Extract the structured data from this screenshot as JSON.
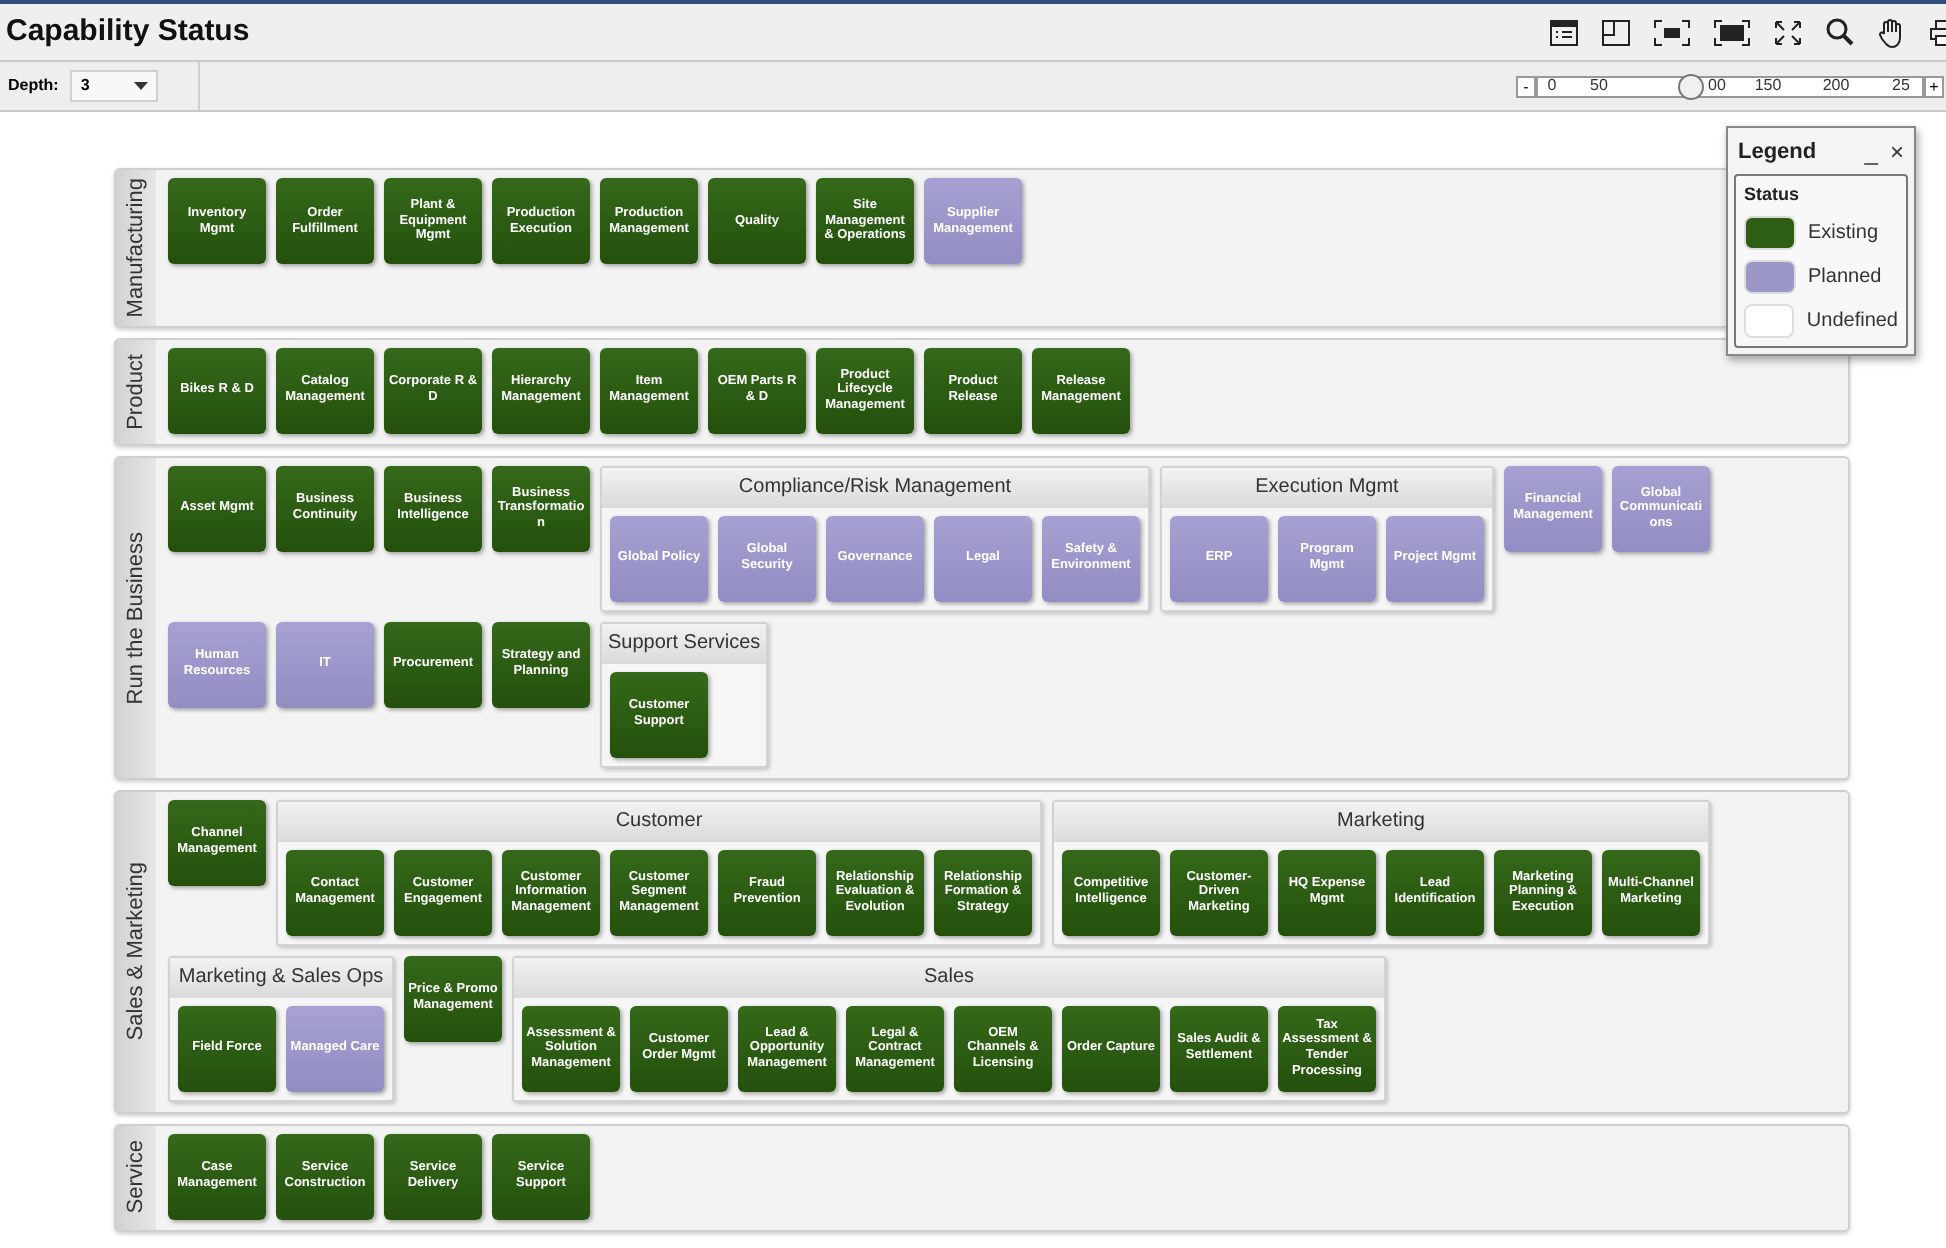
{
  "title": "Capability Status",
  "toolbar": {
    "depth_label": "Depth:",
    "depth_value": "3",
    "zoom": {
      "minus": "-",
      "plus": "+",
      "labels": [
        "0",
        "50",
        "00",
        "150",
        "200",
        "25"
      ],
      "level": 0.4
    }
  },
  "lanes": [
    {
      "label": "Manufacturing",
      "rows": [
        [
          {
            "kind": "capability",
            "name": "Inventory Mgmt",
            "planned": false
          },
          {
            "kind": "capability",
            "name": "Order Fulfillment",
            "planned": false
          },
          {
            "kind": "capability",
            "name": "Plant & Equipment Mgmt",
            "planned": false
          },
          {
            "kind": "capability",
            "name": "Production Execution",
            "planned": false
          },
          {
            "kind": "capability",
            "name": "Production Management",
            "planned": false
          },
          {
            "kind": "capability",
            "name": "Quality",
            "planned": false
          },
          {
            "kind": "capability",
            "name": "Site Management & Operations",
            "planned": false
          },
          {
            "kind": "capability",
            "name": "Supplier Management",
            "planned": true
          }
        ]
      ]
    },
    {
      "label": "Product",
      "rows": [
        [
          {
            "kind": "capability",
            "name": "Bikes R & D",
            "planned": false
          },
          {
            "kind": "capability",
            "name": "Catalog Management",
            "planned": false
          },
          {
            "kind": "capability",
            "name": "Corporate R & D",
            "planned": false
          },
          {
            "kind": "capability",
            "name": "Hierarchy Management",
            "planned": false
          },
          {
            "kind": "capability",
            "name": "Item Management",
            "planned": false
          },
          {
            "kind": "capability",
            "name": "OEM Parts R & D",
            "planned": false
          },
          {
            "kind": "capability",
            "name": "Product Lifecycle Management",
            "planned": false
          },
          {
            "kind": "capability",
            "name": "Product Release",
            "planned": false
          },
          {
            "kind": "capability",
            "name": "Release Management",
            "planned": false
          }
        ]
      ]
    },
    {
      "label": "Run the Business",
      "rows": [
        [
          {
            "kind": "capability",
            "name": "Asset Mgmt",
            "planned": false
          },
          {
            "kind": "capability",
            "name": "Business Continuity",
            "planned": false
          },
          {
            "kind": "capability",
            "name": "Business Intelligence",
            "planned": false
          },
          {
            "kind": "capability",
            "name": "Business Transformation",
            "planned": false
          },
          {
            "kind": "group",
            "name": "Compliance/Risk Management",
            "children": [
              {
                "kind": "capability",
                "name": "Global Policy",
                "planned": true
              },
              {
                "kind": "capability",
                "name": "Global Security",
                "planned": true
              },
              {
                "kind": "capability",
                "name": "Governance",
                "planned": true
              },
              {
                "kind": "capability",
                "name": "Legal",
                "planned": true
              },
              {
                "kind": "capability",
                "name": "Safety & Environment",
                "planned": true
              }
            ]
          },
          {
            "kind": "group",
            "name": "Execution Mgmt",
            "children": [
              {
                "kind": "capability",
                "name": "ERP",
                "planned": true
              },
              {
                "kind": "capability",
                "name": "Program Mgmt",
                "planned": true
              },
              {
                "kind": "capability",
                "name": "Project Mgmt",
                "planned": true
              }
            ]
          },
          {
            "kind": "capability",
            "name": "Financial Management",
            "planned": true
          },
          {
            "kind": "capability",
            "name": "Global Communications",
            "planned": true
          }
        ],
        [
          {
            "kind": "capability",
            "name": "Human Resources",
            "planned": true
          },
          {
            "kind": "capability",
            "name": "IT",
            "planned": true
          },
          {
            "kind": "capability",
            "name": "Procurement",
            "planned": false
          },
          {
            "kind": "capability",
            "name": "Strategy and Planning",
            "planned": false
          },
          {
            "kind": "group",
            "name": "Support Services",
            "children": [
              {
                "kind": "capability",
                "name": "Customer Support",
                "planned": false
              }
            ]
          }
        ]
      ]
    },
    {
      "label": "Sales & Marketing",
      "rows": [
        [
          {
            "kind": "capability",
            "name": "Channel Management",
            "planned": false
          },
          {
            "kind": "group",
            "name": "Customer",
            "children": [
              {
                "kind": "capability",
                "name": "Contact Management",
                "planned": false
              },
              {
                "kind": "capability",
                "name": "Customer Engagement",
                "planned": false
              },
              {
                "kind": "capability",
                "name": "Customer Information Management",
                "planned": false
              },
              {
                "kind": "capability",
                "name": "Customer Segment Management",
                "planned": false
              },
              {
                "kind": "capability",
                "name": "Fraud Prevention",
                "planned": false
              },
              {
                "kind": "capability",
                "name": "Relationship Evaluation & Evolution",
                "planned": false
              },
              {
                "kind": "capability",
                "name": "Relationship Formation & Strategy",
                "planned": false
              }
            ]
          },
          {
            "kind": "group",
            "name": "Marketing",
            "children": [
              {
                "kind": "capability",
                "name": "Competitive Intelligence",
                "planned": false
              },
              {
                "kind": "capability",
                "name": "Customer-Driven Marketing",
                "planned": false
              },
              {
                "kind": "capability",
                "name": "HQ Expense Mgmt",
                "planned": false
              },
              {
                "kind": "capability",
                "name": "Lead Identification",
                "planned": false
              },
              {
                "kind": "capability",
                "name": "Marketing Planning & Execution",
                "planned": false
              },
              {
                "kind": "capability",
                "name": "Multi-Channel Marketing",
                "planned": false
              }
            ]
          }
        ],
        [
          {
            "kind": "group",
            "name": "Marketing & Sales Ops",
            "children": [
              {
                "kind": "capability",
                "name": "Field Force",
                "planned": false
              },
              {
                "kind": "capability",
                "name": "Managed Care",
                "planned": true
              }
            ]
          },
          {
            "kind": "capability",
            "name": "Price & Promo Management",
            "planned": false
          },
          {
            "kind": "group",
            "name": "Sales",
            "children": [
              {
                "kind": "capability",
                "name": "Assessment & Solution Management",
                "planned": false
              },
              {
                "kind": "capability",
                "name": "Customer Order Mgmt",
                "planned": false
              },
              {
                "kind": "capability",
                "name": "Lead & Opportunity Management",
                "planned": false
              },
              {
                "kind": "capability",
                "name": "Legal & Contract Management",
                "planned": false
              },
              {
                "kind": "capability",
                "name": "OEM Channels & Licensing",
                "planned": false
              },
              {
                "kind": "capability",
                "name": "Order Capture",
                "planned": false
              },
              {
                "kind": "capability",
                "name": "Sales Audit & Settlement",
                "planned": false
              },
              {
                "kind": "capability",
                "name": "Tax Assessment & Tender Processing",
                "planned": false
              }
            ]
          }
        ]
      ]
    },
    {
      "label": "Service",
      "rows": [
        [
          {
            "kind": "capability",
            "name": "Case Management",
            "planned": false
          },
          {
            "kind": "capability",
            "name": "Service Construction",
            "planned": false
          },
          {
            "kind": "capability",
            "name": "Service Delivery",
            "planned": false
          },
          {
            "kind": "capability",
            "name": "Service Support",
            "planned": false
          }
        ]
      ]
    }
  ],
  "legend": {
    "title": "Legend",
    "minimize": "_",
    "close": "×",
    "section": "Status",
    "entries": [
      {
        "label": "Existing",
        "color": "#2e5e14"
      },
      {
        "label": "Planned",
        "color": "#9c97c9"
      },
      {
        "label": "Undefined",
        "color": "#ffffff"
      }
    ]
  }
}
